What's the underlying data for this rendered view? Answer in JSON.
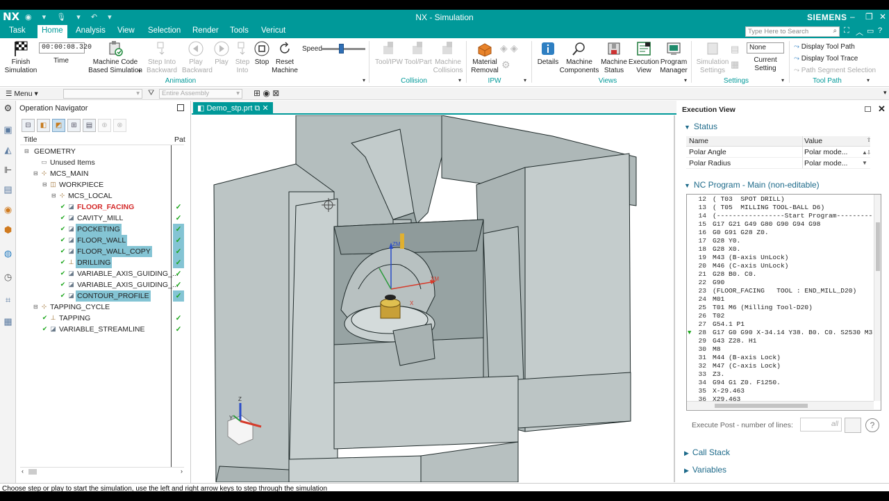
{
  "app": {
    "logo": "NX",
    "title": "NX - Simulation",
    "brand": "SIEMENS",
    "window_controls": [
      "–",
      "❐",
      "✕"
    ]
  },
  "menubar": {
    "tabs": [
      "Task",
      "Home",
      "Analysis",
      "View",
      "Selection",
      "Render",
      "Tools",
      "Vericut"
    ],
    "active_tab": "Home",
    "search_placeholder": "Type Here to Search"
  },
  "ribbon": {
    "finish_simulation": "Finish\nSimulation",
    "time_value": "00:00:08.320",
    "time_label": "Time",
    "machine_code": "Machine Code\nBased Simulation",
    "step_into_backward": "Step Into\nBackward",
    "play_backward": "Play\nBackward",
    "play": "Play",
    "step_into": "Step\nInto",
    "stop": "Stop",
    "reset_machine": "Reset\nMachine",
    "speed_label": "Speed",
    "speed_level": 0.45,
    "tool_ipw": "Tool/IPW",
    "tool_part": "Tool/Part",
    "machine_collisions": "Machine\nCollisions",
    "material_removal": "Material\nRemoval",
    "details": "Details",
    "machine_components": "Machine\nComponents",
    "machine_status": "Machine\nStatus",
    "execution_view": "Execution\nView",
    "program_manager": "Program\nManager",
    "simulation_settings": "Simulation\nSettings",
    "current_setting_value": "None",
    "current_setting": "Current\nSetting",
    "display_tool_path": "Display Tool Path",
    "display_tool_trace": "Display Tool Trace",
    "path_segment_selection": "Path Segment Selection",
    "groups": {
      "animation": "Animation",
      "collision": "Collision",
      "ipw": "IPW",
      "views": "Views",
      "settings": "Settings",
      "tool_path": "Tool Path"
    }
  },
  "subbar": {
    "menu": "Menu",
    "filter_placeholder": "",
    "assembly": "Entire Assembly"
  },
  "navigator": {
    "title": "Operation Navigator",
    "col_title": "Title",
    "col_path": "Pat",
    "rows": [
      {
        "label": "GEOMETRY",
        "indent": 0,
        "icon": "",
        "check": false,
        "selected": false,
        "red": false
      },
      {
        "label": "Unused Items",
        "indent": 1,
        "icon": "folder",
        "check": false,
        "selected": false,
        "red": false
      },
      {
        "label": "MCS_MAIN",
        "indent": 1,
        "icon": "mcs",
        "check": false,
        "selected": false,
        "red": false
      },
      {
        "label": "WORKPIECE",
        "indent": 2,
        "icon": "workpiece",
        "check": false,
        "selected": false,
        "red": false
      },
      {
        "label": "MCS_LOCAL",
        "indent": 3,
        "icon": "mcs",
        "check": false,
        "selected": false,
        "red": false
      },
      {
        "label": "FLOOR_FACING",
        "indent": 4,
        "icon": "op",
        "check": true,
        "selected": false,
        "red": true
      },
      {
        "label": "CAVITY_MILL",
        "indent": 4,
        "icon": "op",
        "check": true,
        "selected": false,
        "red": false
      },
      {
        "label": "POCKETING",
        "indent": 4,
        "icon": "op",
        "check": true,
        "selected": true,
        "red": false
      },
      {
        "label": "FLOOR_WALL",
        "indent": 4,
        "icon": "op",
        "check": true,
        "selected": true,
        "red": false
      },
      {
        "label": "FLOOR_WALL_COPY",
        "indent": 4,
        "icon": "op",
        "check": true,
        "selected": true,
        "red": false
      },
      {
        "label": "DRILLING",
        "indent": 4,
        "icon": "drill",
        "check": true,
        "selected": true,
        "red": false
      },
      {
        "label": "VARIABLE_AXIS_GUIDING_...",
        "indent": 4,
        "icon": "op",
        "check": true,
        "selected": false,
        "red": false
      },
      {
        "label": "VARIABLE_AXIS_GUIDING_...",
        "indent": 4,
        "icon": "op",
        "check": true,
        "selected": false,
        "red": false
      },
      {
        "label": "CONTOUR_PROFILE",
        "indent": 4,
        "icon": "op",
        "check": true,
        "selected": true,
        "red": false
      },
      {
        "label": "TAPPING_CYCLE",
        "indent": 1,
        "icon": "cycle",
        "check": false,
        "selected": false,
        "red": false
      },
      {
        "label": "TAPPING",
        "indent": 2,
        "icon": "drill",
        "check": true,
        "selected": false,
        "red": false
      },
      {
        "label": "VARIABLE_STREAMLINE",
        "indent": 2,
        "icon": "op",
        "check": true,
        "selected": false,
        "red": false
      }
    ]
  },
  "document": {
    "tab": "Demo_stp.prt"
  },
  "viewport": {
    "axis_zm": "ZM",
    "axis_xm": "XM",
    "axis_x": "X",
    "triad_z": "Z",
    "triad_y": "Y"
  },
  "exec": {
    "title": "Execution View",
    "status_title": "Status",
    "col_name": "Name",
    "col_value": "Value",
    "status_rows": [
      {
        "name": "Polar Angle",
        "value": "Polar mode..."
      },
      {
        "name": "Polar Radius",
        "value": "Polar mode..."
      }
    ],
    "nc_title": "NC Program - Main (non-editable)",
    "current_line": "28",
    "lines": [
      {
        "n": "12",
        "t": "( T03  SPOT DRILL)"
      },
      {
        "n": "13",
        "t": "( T05  MILLING TOOL-BALL D6)"
      },
      {
        "n": "14",
        "t": "(-----------------Start Program---------"
      },
      {
        "n": "15",
        "t": "G17 G21 G49 G80 G90 G94 G98"
      },
      {
        "n": "16",
        "t": "G0 G91 G28 Z0."
      },
      {
        "n": "17",
        "t": "G28 Y0."
      },
      {
        "n": "18",
        "t": "G28 X0."
      },
      {
        "n": "19",
        "t": "M43 (B-axis UnLock)"
      },
      {
        "n": "20",
        "t": "M46 (C-axis UnLock)"
      },
      {
        "n": "21",
        "t": "G28 B0. C0."
      },
      {
        "n": "22",
        "t": "G90"
      },
      {
        "n": "23",
        "t": "(FLOOR_FACING   TOOL : END_MILL_D20)"
      },
      {
        "n": "24",
        "t": "M01"
      },
      {
        "n": "25",
        "t": "T01 M6 (Milling Tool-D20)"
      },
      {
        "n": "26",
        "t": "T02"
      },
      {
        "n": "27",
        "t": "G54.1 P1"
      },
      {
        "n": "28",
        "t": "G17 G0 G90 X-34.14 Y38. B0. C0. S2530 M3"
      },
      {
        "n": "29",
        "t": "G43 Z28. H1"
      },
      {
        "n": "30",
        "t": "M8"
      },
      {
        "n": "31",
        "t": "M44 (B-axis Lock)"
      },
      {
        "n": "32",
        "t": "M47 (C-axis Lock)"
      },
      {
        "n": "33",
        "t": "Z3."
      },
      {
        "n": "34",
        "t": "G94 G1 Z0. F1250."
      },
      {
        "n": "35",
        "t": "X-29.463"
      },
      {
        "n": "36",
        "t": "X29.463"
      }
    ],
    "execute_post": "Execute Post - number of lines:",
    "execute_value": "all",
    "call_stack": "Call Stack",
    "variables": "Variables"
  },
  "statusbar": {
    "text": "Choose step or play to start the simulation, use the left and right arrow keys to step through the simulation"
  }
}
